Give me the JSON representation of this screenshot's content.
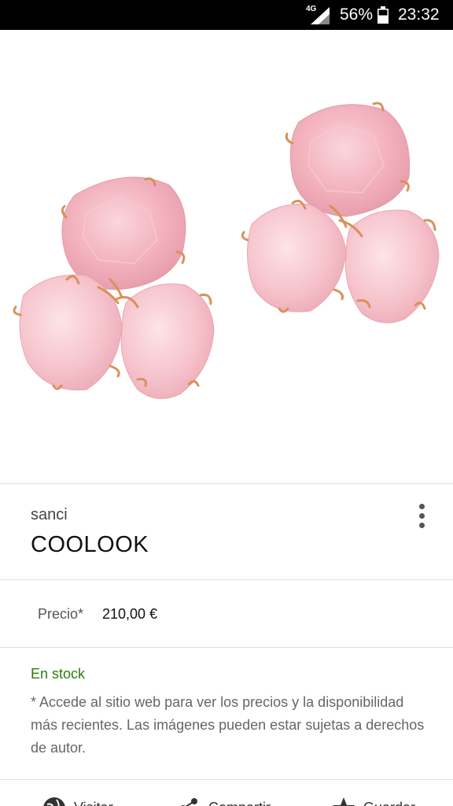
{
  "status_bar": {
    "network": "4G",
    "battery_percent": "56%",
    "time": "23:32"
  },
  "hero": {
    "image": "rose-quartz-earrings-image"
  },
  "product": {
    "source": "sanci",
    "name": "COOLOOK",
    "more_icon": "more-vertical-icon"
  },
  "price": {
    "label": "Precio*",
    "value": "210,00 €"
  },
  "availability": {
    "stock": "En stock",
    "disclaimer": "* Accede al sitio web para ver los precios y la disponibilidad más recientes. Las imágenes pueden estar sujetas a derechos de autor."
  },
  "actions": [
    {
      "label": "Visitar",
      "icon": "globe-icon"
    },
    {
      "label": "Compartir",
      "icon": "share-icon"
    },
    {
      "label": "Guardar",
      "icon": "star-icon"
    }
  ],
  "colors": {
    "stock_green": "#2e7d0a",
    "quartz_pink": "#f4b9c4",
    "gold_prong": "#d9915a"
  }
}
